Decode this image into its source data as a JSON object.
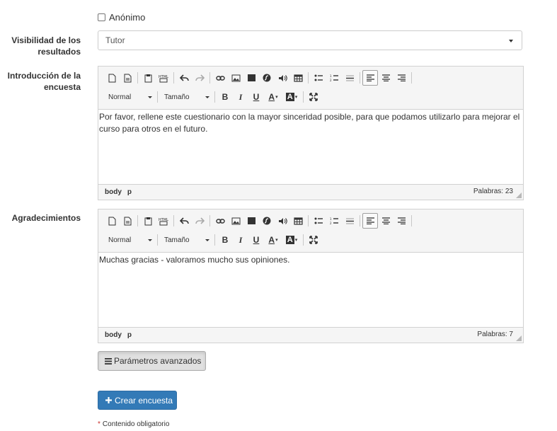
{
  "anonymous": {
    "label": "Anónimo",
    "checked": false
  },
  "visibility": {
    "label": "Visibilidad de los resultados",
    "value": "Tutor"
  },
  "toolbar": {
    "format_label": "Normal",
    "size_label": "Tamaño",
    "bold": "B",
    "italic": "I",
    "underline": "U",
    "font_color": "A",
    "bg_color": "A"
  },
  "intro": {
    "label": "Introducción de la encuesta",
    "content": "Por favor, rellene este cuestionario con la mayor sinceridad posible, para que podamos utilizarlo para mejorar el curso para otros en el futuro.",
    "path_body": "body",
    "path_p": "p",
    "word_count": "Palabras: 23"
  },
  "thanks": {
    "label": "Agradecimientos",
    "content": "Muchas gracias - valoramos mucho sus opiniones.",
    "path_body": "body",
    "path_p": "p",
    "word_count": "Palabras: 7"
  },
  "advanced_button": "Parámetros avanzados",
  "create_button": "Crear encuesta",
  "required_note": "Contenido obligatorio",
  "colors": {
    "primary": "#337ab7",
    "required": "#c9302c"
  }
}
